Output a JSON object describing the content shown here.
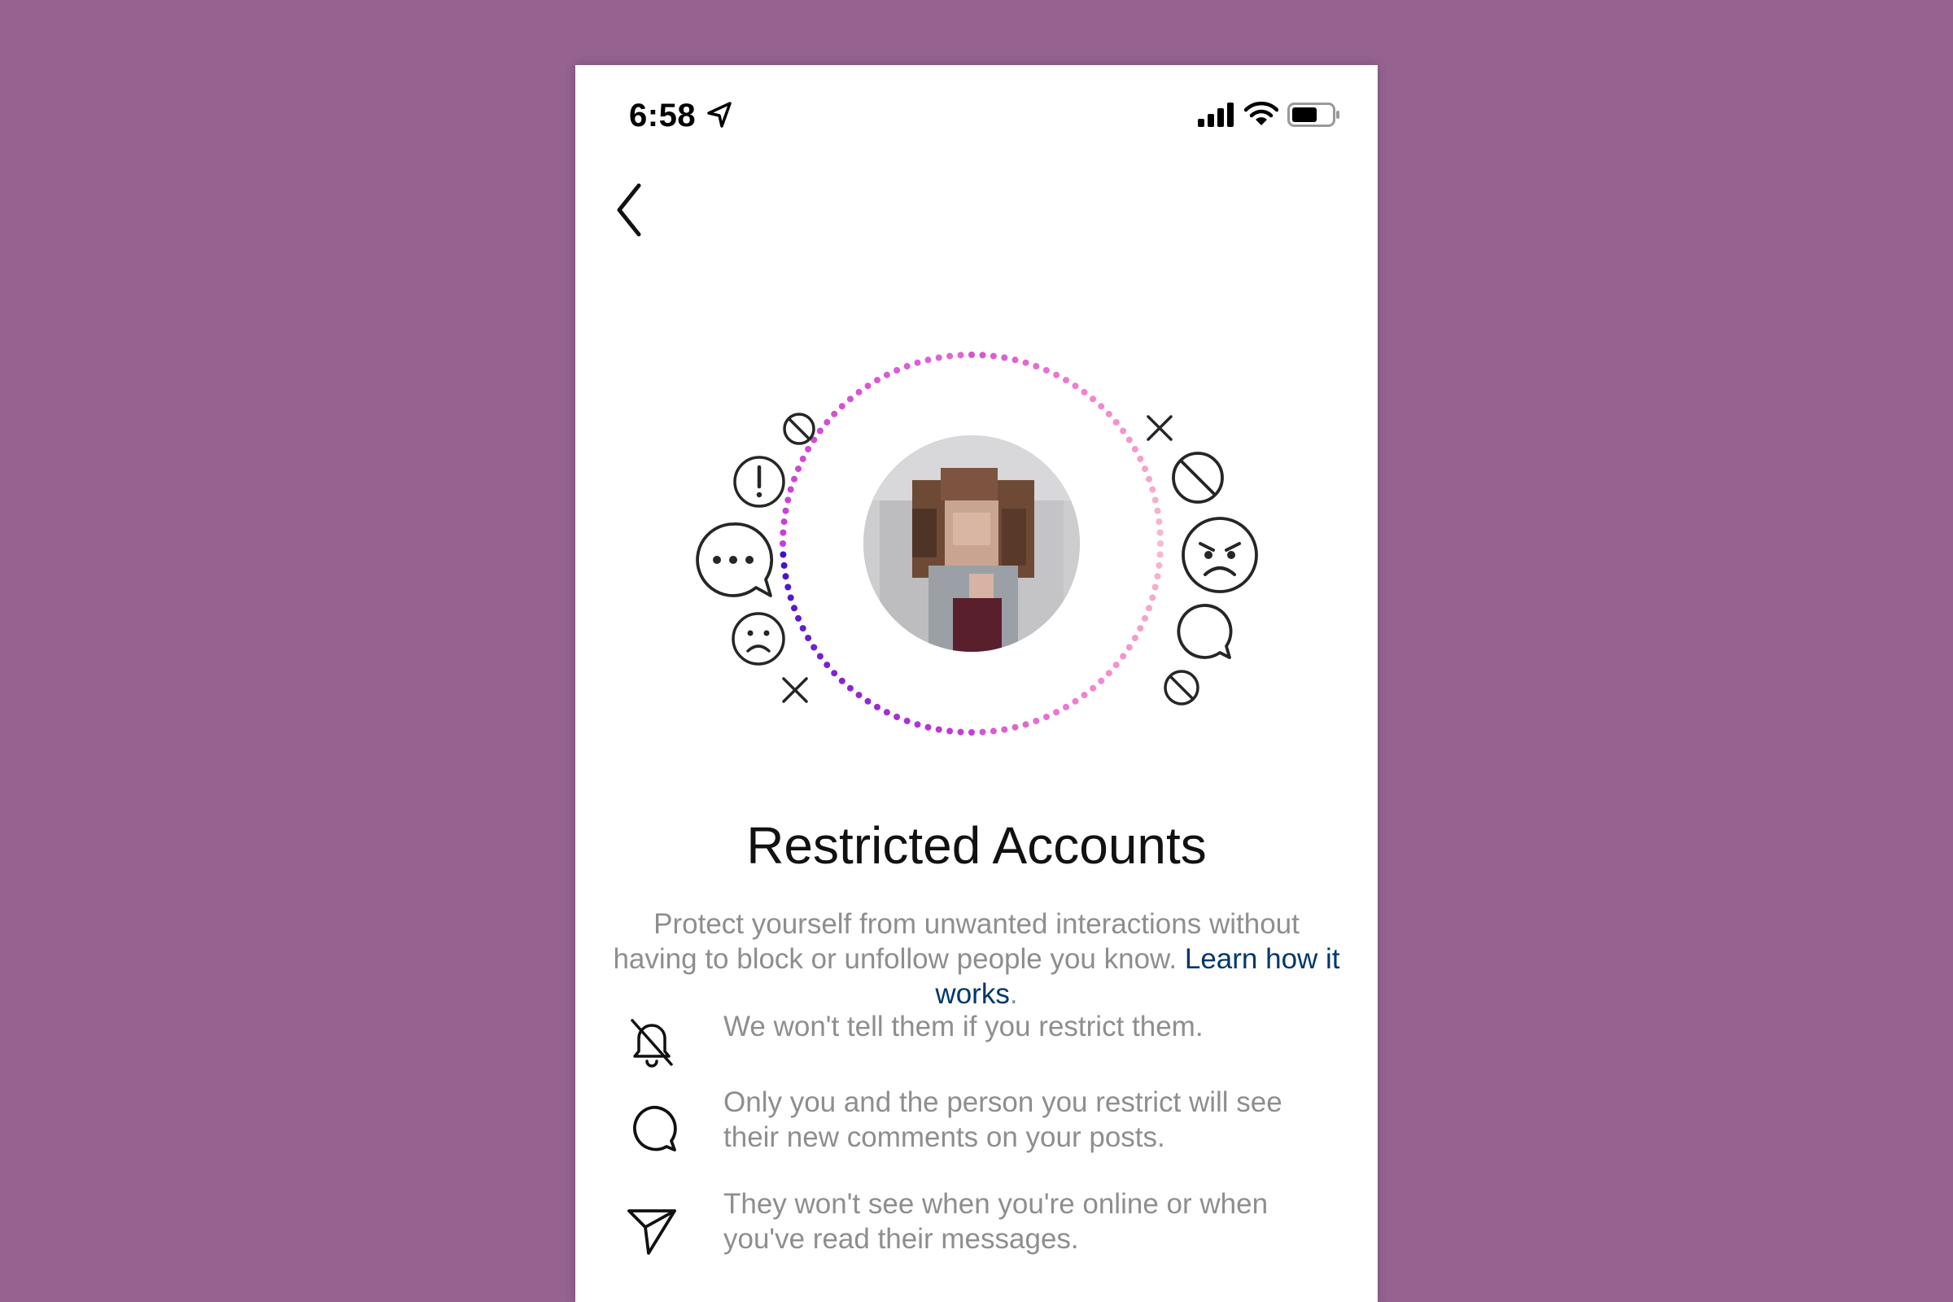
{
  "status_bar": {
    "time": "6:58"
  },
  "screen": {
    "title": "Restricted Accounts",
    "description": "Protect yourself from unwanted interactions without having to block or unfollow people you know.",
    "learn_more": "Learn how it works",
    "learn_more_suffix": "."
  },
  "features": [
    {
      "icon": "bell-off-icon",
      "text": "We won't tell them if you restrict them."
    },
    {
      "icon": "comment-icon",
      "text": "Only you and the person you restrict will see their new comments on your posts."
    },
    {
      "icon": "direct-send-icon",
      "text": "They won't see when you're online or when you've read their messages."
    }
  ],
  "colors": {
    "background": "#96628f",
    "link": "#00376b",
    "muted_text": "#8e8e8e",
    "ring_gradient": [
      "#3b0fc9",
      "#c23ad6",
      "#f47fd1",
      "#f6bccb"
    ]
  }
}
